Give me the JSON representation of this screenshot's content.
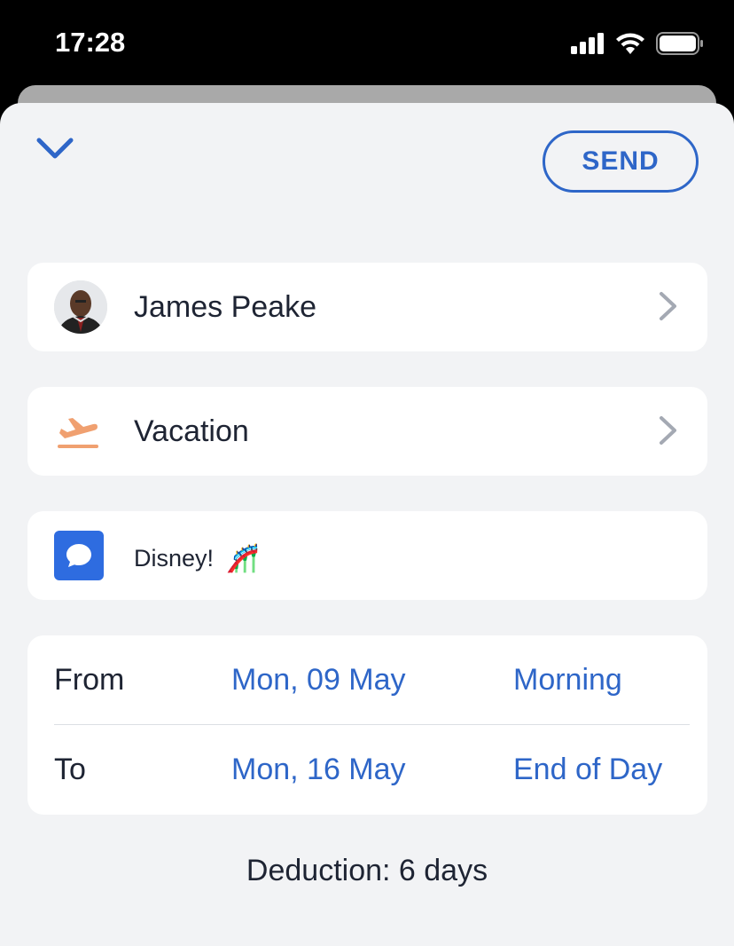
{
  "status_bar": {
    "time": "17:28",
    "icons": [
      "cellular-signal-icon",
      "wifi-icon",
      "battery-icon"
    ]
  },
  "header": {
    "collapse_icon": "chevron-down-icon",
    "send_label": "SEND"
  },
  "employee": {
    "name": "James Peake",
    "avatar": "avatar-photo"
  },
  "leave_type": {
    "label": "Vacation",
    "icon": "airplane-takeoff-icon",
    "icon_color": "#f0a070"
  },
  "note": {
    "text": "Disney!",
    "emoji": "🎢",
    "icon": "message-bubble-icon"
  },
  "dates": {
    "from": {
      "label": "From",
      "date": "Mon, 09 May",
      "part": "Morning"
    },
    "to": {
      "label": "To",
      "date": "Mon, 16 May",
      "part": "End of Day"
    }
  },
  "deduction": "Deduction: 6 days",
  "colors": {
    "accent": "#2e66c8",
    "background": "#f2f3f5",
    "card": "#ffffff",
    "text": "#1e2433"
  }
}
